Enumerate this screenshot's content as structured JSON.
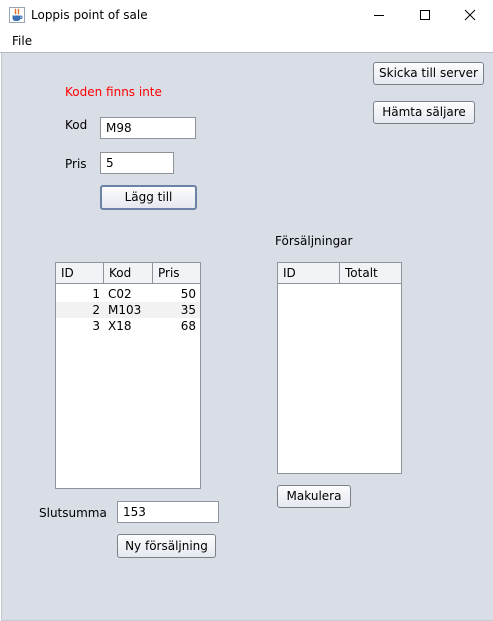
{
  "window": {
    "title": "Loppis point of sale"
  },
  "menu": {
    "file": "File"
  },
  "buttons": {
    "send_to_server": "Skicka till server",
    "fetch_sellers": "Hämta säljare",
    "add": "Lägg till",
    "cancel_sale": "Makulera",
    "new_sale": "Ny försäljning"
  },
  "form": {
    "error_message": "Koden finns inte",
    "code_label": "Kod",
    "code_value": "M98",
    "price_label": "Pris",
    "price_value": "5",
    "total_label": "Slutsumma",
    "total_value": "153"
  },
  "items_table": {
    "columns": [
      "ID",
      "Kod",
      "Pris"
    ],
    "rows": [
      {
        "id": "1",
        "code": "C02",
        "price": "50"
      },
      {
        "id": "2",
        "code": "M103",
        "price": "35"
      },
      {
        "id": "3",
        "code": "X18",
        "price": "68"
      }
    ]
  },
  "sales_table": {
    "heading": "Försäljningar",
    "columns": [
      "ID",
      "Totalt"
    ],
    "rows": []
  },
  "colors": {
    "error": "#ff0000",
    "panel_background": "#d9dde6",
    "button_border": "#7a7f88",
    "focused_border": "#6b82a6"
  }
}
